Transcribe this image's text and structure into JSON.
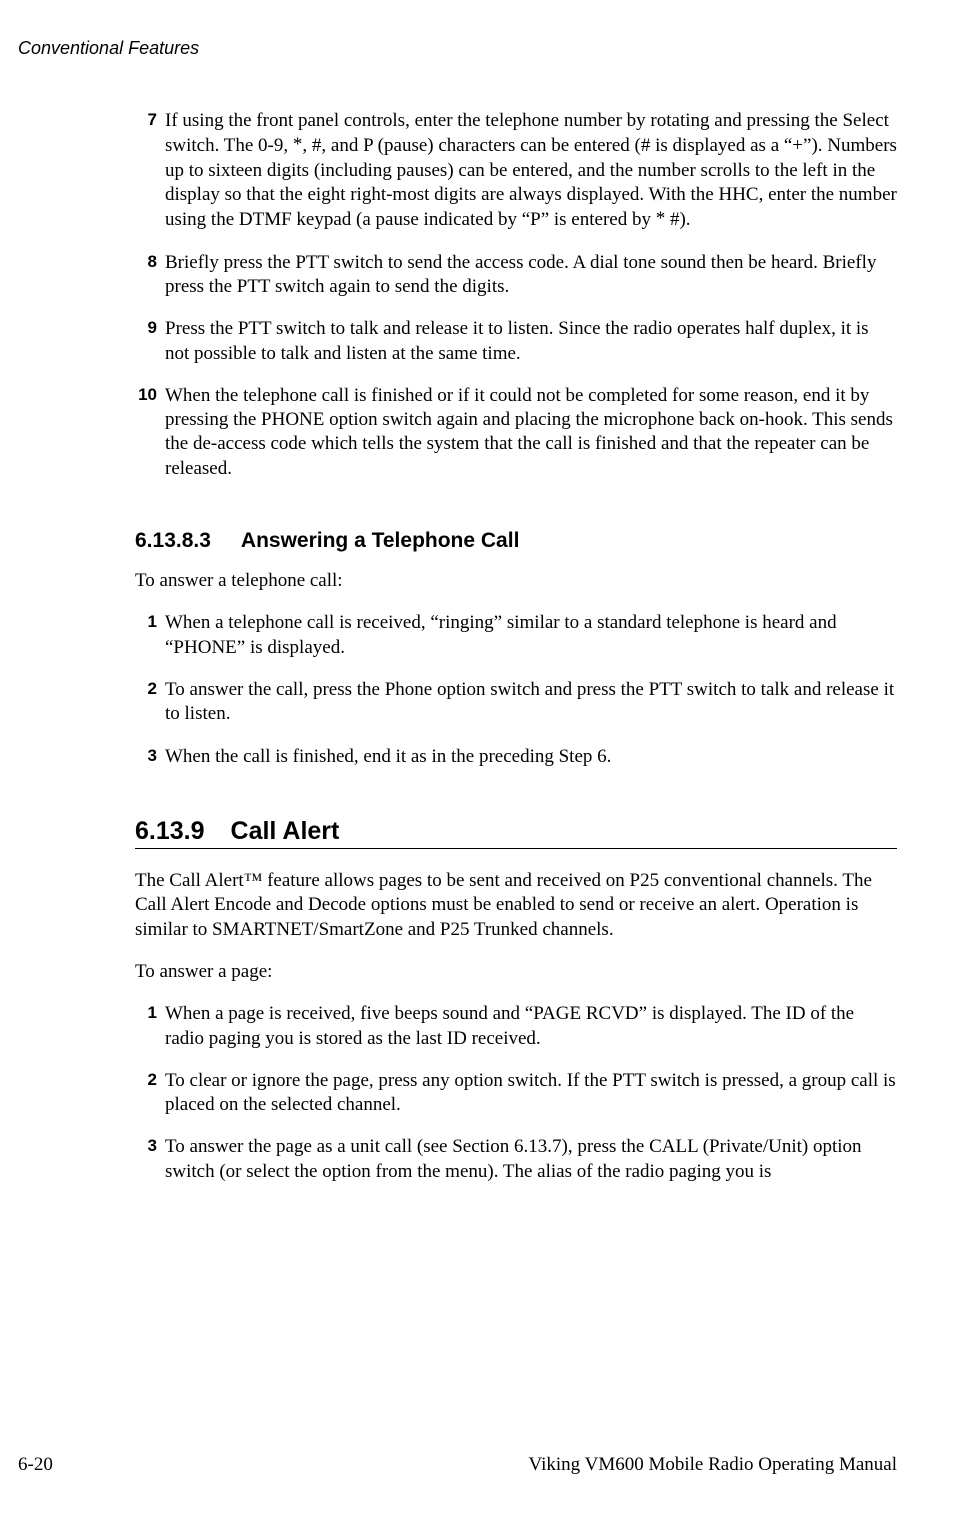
{
  "header": {
    "section_title": "Conventional Features"
  },
  "steps_a": [
    {
      "num": "7",
      "text_pre": "If using the front panel controls, enter the telephone number by rotating and pressing the Select switch. The 0-9, ",
      "text_mid": ", #, and P (pause) characters can be entered (# is displayed as a “+”). Numbers up to sixteen digits (including pauses) can be entered, and the number scrolls to the left in the display so that the eight right-most digits are always displayed. With the HHC, enter the number using the DTMF keypad (a pause indicated by “P” is entered by ",
      "text_end": " #)."
    },
    {
      "num": "8",
      "text": "Briefly press the PTT switch to send the access code. A dial tone sound then be heard. Briefly press the PTT switch again to send the digits."
    },
    {
      "num": "9",
      "text": "Press the PTT switch to talk and release it to listen. Since the radio operates half duplex, it is not possible to talk and listen at the same time."
    },
    {
      "num": "10",
      "text": "When the telephone call is finished or if it could not be completed for some reason, end it by pressing the PHONE option switch again and placing the microphone back on-hook. This sends the de-access code which tells the system that the call is finished and that the repeater can be released."
    }
  ],
  "section_61383": {
    "number": "6.13.8.3",
    "title": "Answering a Telephone Call",
    "intro": "To answer a telephone call:"
  },
  "steps_b": [
    {
      "num": "1",
      "text": "When a telephone call is received, “ringing” similar to a standard telephone is heard and “PHONE” is displayed."
    },
    {
      "num": "2",
      "text": "To answer the call, press the Phone option switch and press the PTT switch to talk and release it to listen."
    },
    {
      "num": "3",
      "text": "When the call is finished, end it as in the preceding Step 6."
    }
  ],
  "section_6139": {
    "number": "6.13.9",
    "title": "Call Alert",
    "para1": "The Call Alert™ feature allows pages to be sent and received on P25 conventional channels. The Call Alert Encode and Decode options must be enabled to send or receive an alert. Operation is similar to SMARTNET/SmartZone and P25 Trunked channels.",
    "para2": "To answer a page:"
  },
  "steps_c": [
    {
      "num": "1",
      "text": "When a page is received, five beeps sound and “PAGE RCVD” is displayed. The ID of the radio paging you is stored as the last ID received."
    },
    {
      "num": "2",
      "text": "To clear or ignore the page, press any option switch. If the PTT switch is pressed, a group call is placed on the selected channel."
    },
    {
      "num": "3",
      "text": "To answer the page as a unit call (see Section 6.13.7), press the CALL (Private/Unit) option switch (or select the option from the menu). The alias of the radio paging you is"
    }
  ],
  "footer": {
    "page": "6-20",
    "doc": "Viking VM600 Mobile Radio Operating Manual"
  },
  "star": "*"
}
